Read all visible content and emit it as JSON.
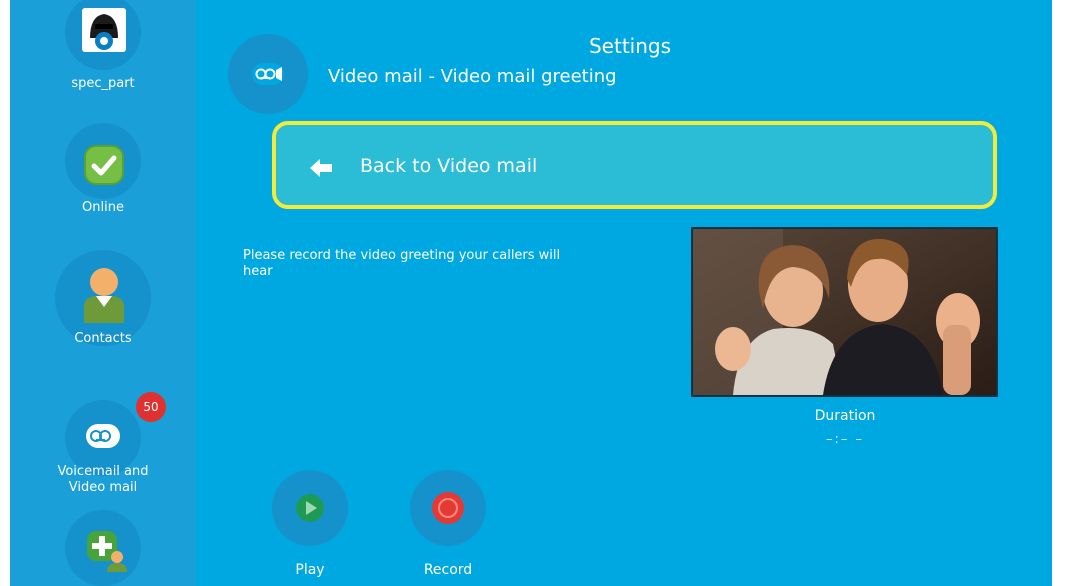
{
  "header": {
    "title": "Settings",
    "subtitle": "Video mail - Video mail greeting"
  },
  "sidebar": {
    "items": [
      {
        "label": "spec_part",
        "icon": "user-avatar-icon"
      },
      {
        "label": "Online",
        "icon": "online-check-icon"
      },
      {
        "label": "Contacts",
        "icon": "contacts-person-icon"
      },
      {
        "label": "Voicemail and\nVideo mail",
        "icon": "video-mail-icon",
        "badge": "50"
      },
      {
        "label": "",
        "icon": "add-contact-icon"
      }
    ]
  },
  "back_button": {
    "label": "Back to Video mail",
    "icon": "back-arrow-icon"
  },
  "instructions": "Please record the video greeting your callers will hear",
  "preview": {
    "duration_label": "Duration",
    "duration_value": "–:– –"
  },
  "controls": {
    "play_label": "Play",
    "record_label": "Record"
  },
  "colors": {
    "background": "#00a8e1",
    "sidebar": "#1a9fd8",
    "back_button": "#2bbcd6",
    "focus_border": "#f3eb3c",
    "badge": "#e03131",
    "record": "#e53935",
    "play": "#1f9a55"
  }
}
